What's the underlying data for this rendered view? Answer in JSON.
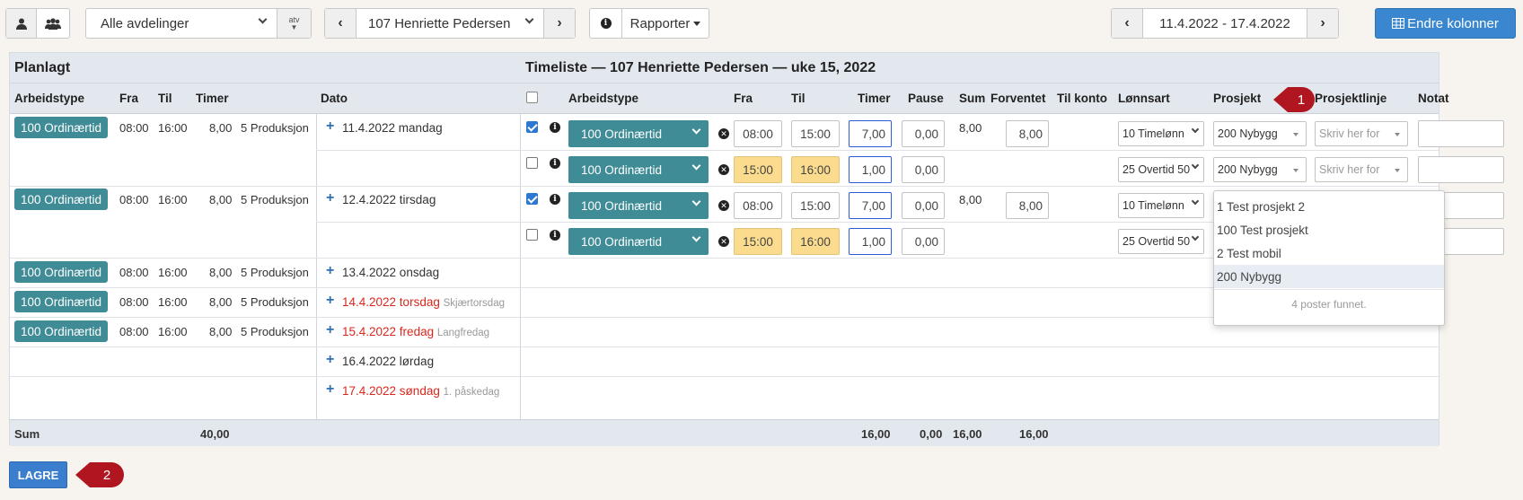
{
  "toolbar": {
    "department": "Alle avdelinger",
    "atv": "atv",
    "employee": "107 Henriette Pedersen",
    "reports": "Rapporter",
    "date_range": "11.4.2022 - 17.4.2022",
    "change_columns": "Endre kolonner"
  },
  "planned": {
    "title": "Planlagt",
    "columns": [
      "Arbeidstype",
      "Fra",
      "Til",
      "Timer",
      "Dato"
    ],
    "rows": [
      {
        "type": "100 Ordinærtid",
        "from": "08:00",
        "to": "16:00",
        "hours": "8,00",
        "dept": "5 Produksjon",
        "date": "11.4.2022 mandag",
        "note": ""
      },
      {
        "type": "100 Ordinærtid",
        "from": "08:00",
        "to": "16:00",
        "hours": "8,00",
        "dept": "5 Produksjon",
        "date": "12.4.2022 tirsdag",
        "note": ""
      },
      {
        "type": "100 Ordinærtid",
        "from": "08:00",
        "to": "16:00",
        "hours": "8,00",
        "dept": "5 Produksjon",
        "date": "13.4.2022 onsdag",
        "note": ""
      },
      {
        "type": "100 Ordinærtid",
        "from": "08:00",
        "to": "16:00",
        "hours": "8,00",
        "dept": "5 Produksjon",
        "date": "14.4.2022 torsdag",
        "note": "Skjærtorsdag"
      },
      {
        "type": "100 Ordinærtid",
        "from": "08:00",
        "to": "16:00",
        "hours": "8,00",
        "dept": "5 Produksjon",
        "date": "15.4.2022 fredag",
        "note": "Langfredag"
      },
      {
        "date": "16.4.2022 lørdag",
        "note": ""
      },
      {
        "date": "17.4.2022 søndag",
        "note": "1. påskedag"
      }
    ]
  },
  "timesheet": {
    "title": "Timeliste — 107 Henriette Pedersen — uke 15, 2022",
    "columns": [
      "Arbeidstype",
      "Fra",
      "Til",
      "Timer",
      "Pause",
      "Sum",
      "Forventet",
      "Til konto",
      "Lønnsart",
      "Prosjekt",
      "Prosjektlinje",
      "Notat"
    ],
    "rows": [
      {
        "checked": true,
        "type": "100 Ordinærtid",
        "from": "08:00",
        "to": "15:00",
        "hours": "7,00",
        "pause": "0,00",
        "sum": "8,00",
        "expected": "8,00",
        "wage": "10 Timelønn",
        "project": "200 Nybygg",
        "line": "Skriv her for"
      },
      {
        "checked": false,
        "type": "100 Ordinærtid",
        "from": "15:00",
        "to": "16:00",
        "hours": "1,00",
        "pause": "0,00",
        "wage": "25 Overtid 50",
        "project": "200 Nybygg",
        "line": "Skriv her for"
      },
      {
        "checked": true,
        "type": "100 Ordinærtid",
        "from": "08:00",
        "to": "15:00",
        "hours": "7,00",
        "pause": "0,00",
        "sum": "8,00",
        "expected": "8,00",
        "wage": "10 Timelønn"
      },
      {
        "checked": false,
        "type": "100 Ordinærtid",
        "from": "15:00",
        "to": "16:00",
        "hours": "1,00",
        "pause": "0,00",
        "wage": "25 Overtid 50"
      }
    ]
  },
  "project_menu": {
    "options": [
      "1 Test prosjekt 2",
      "100 Test prosjekt",
      "2 Test mobil",
      "200 Nybygg"
    ],
    "footer": "4 poster funnet."
  },
  "sum": {
    "label": "Sum",
    "planned_hours": "40,00",
    "hours": "16,00",
    "pause": "0,00",
    "sum": "16,00",
    "expected": "16,00"
  },
  "save_label": "LAGRE",
  "callouts": [
    "1",
    "2"
  ],
  "colors": {
    "tag": "#3f8c96",
    "primary": "#3a87cf",
    "weekend": "#d9281e",
    "callout": "#b01620",
    "highlight": "#fbdc8e"
  }
}
